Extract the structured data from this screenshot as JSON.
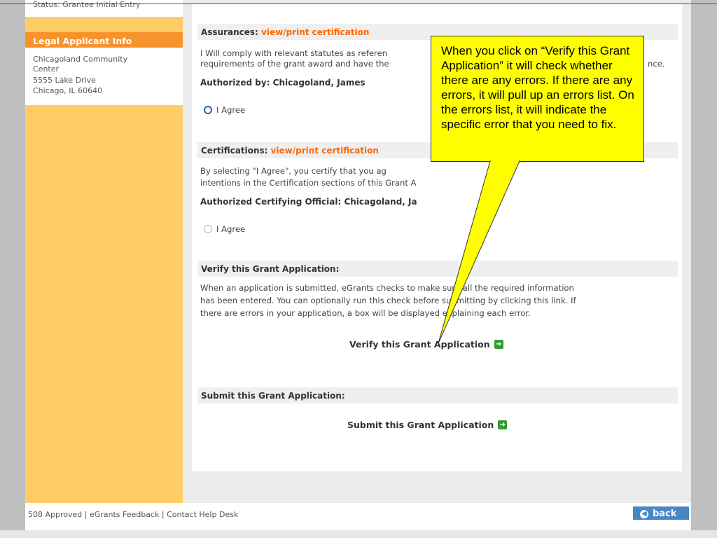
{
  "sidebar": {
    "status_text": "Status: Grantee Initial Entry",
    "heading": "Legal Applicant Info",
    "info_lines": [
      "Chicagoland Community",
      "Center",
      "5555 Lake Drive",
      "Chicago, IL 60640"
    ]
  },
  "assurances": {
    "title": "Assurances: ",
    "link": "view/print certification",
    "text_line1": "I Will comply with relevant statutes as referen",
    "text_line1_end": "nce.",
    "text_line2": "requirements of the grant award and have the",
    "authorized": "Authorized by: Chicagoland, James",
    "agree_label": "I Agree"
  },
  "certifications": {
    "title": "Certifications: ",
    "link": "view/print certification",
    "text_line1": "By selecting \"I Agree\", you certify that you ag",
    "text_line2": "intentions in the Certification sections of this Grant A",
    "authorized": "Authorized Certifying Official: Chicagoland, Ja",
    "agree_label": "I Agree"
  },
  "verify": {
    "title": "Verify this Grant Application:",
    "text_line1": "When an application is submitted, eGrants checks to make sure all the required information",
    "text_line2": "has been entered. You can optionally run this check before submitting by clicking this link. If",
    "text_line3": "there are errors in your application, a box will be displayed explaining each error.",
    "action_label": "Verify this Grant Application"
  },
  "submit": {
    "title": "Submit this Grant Application:",
    "action_label": "Submit this Grant Application"
  },
  "footer": {
    "links": "508 Approved  |  eGrants Feedback  |  Contact Help Desk",
    "back_label": "back"
  },
  "callout": {
    "text": "When you click on “Verify this Grant Application” it will check whether there are any errors.  If there are any errors, it will pull up an errors list.  On the errors list, it will indicate the specific error that you need to fix."
  },
  "colors": {
    "sidebar": "#ffcc66",
    "sidebar_heading": "#f7932a",
    "link": "#ff6600",
    "callout": "#ffff00",
    "back_button": "#4a86c5"
  },
  "icons": {
    "action_arrow": "green-arrow-icon",
    "back": "back-arrow-icon"
  }
}
